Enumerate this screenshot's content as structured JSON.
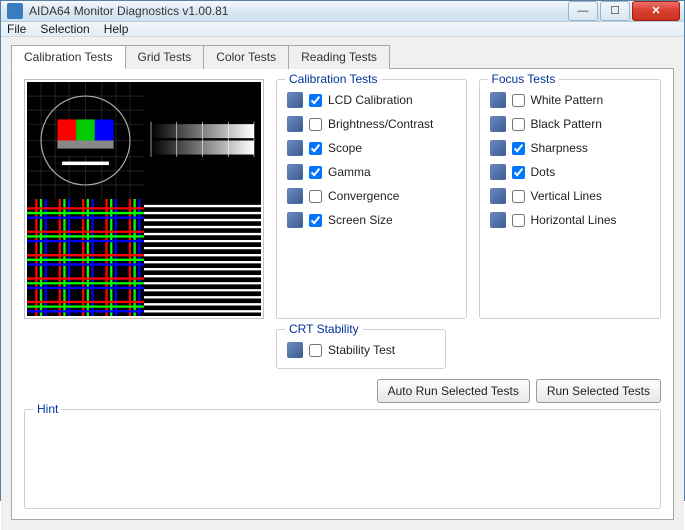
{
  "window": {
    "title": "AIDA64 Monitor Diagnostics v1.00.81"
  },
  "menu": {
    "file": "File",
    "selection": "Selection",
    "help": "Help"
  },
  "tabs": [
    {
      "label": "Calibration Tests",
      "active": true
    },
    {
      "label": "Grid Tests",
      "active": false
    },
    {
      "label": "Color Tests",
      "active": false
    },
    {
      "label": "Reading Tests",
      "active": false
    }
  ],
  "groups": {
    "calibration": {
      "legend": "Calibration Tests",
      "items": [
        {
          "label": "LCD Calibration",
          "checked": true
        },
        {
          "label": "Brightness/Contrast",
          "checked": false
        },
        {
          "label": "Scope",
          "checked": true
        },
        {
          "label": "Gamma",
          "checked": true
        },
        {
          "label": "Convergence",
          "checked": false
        },
        {
          "label": "Screen Size",
          "checked": true
        }
      ]
    },
    "focus": {
      "legend": "Focus Tests",
      "items": [
        {
          "label": "White Pattern",
          "checked": false
        },
        {
          "label": "Black Pattern",
          "checked": false
        },
        {
          "label": "Sharpness",
          "checked": true
        },
        {
          "label": "Dots",
          "checked": true
        },
        {
          "label": "Vertical Lines",
          "checked": false
        },
        {
          "label": "Horizontal Lines",
          "checked": false
        }
      ]
    },
    "crt": {
      "legend": "CRT Stability",
      "items": [
        {
          "label": "Stability Test",
          "checked": false
        }
      ]
    }
  },
  "buttons": {
    "auto": "Auto Run Selected Tests",
    "run": "Run Selected Tests"
  },
  "hint": {
    "legend": "Hint",
    "text": ""
  }
}
